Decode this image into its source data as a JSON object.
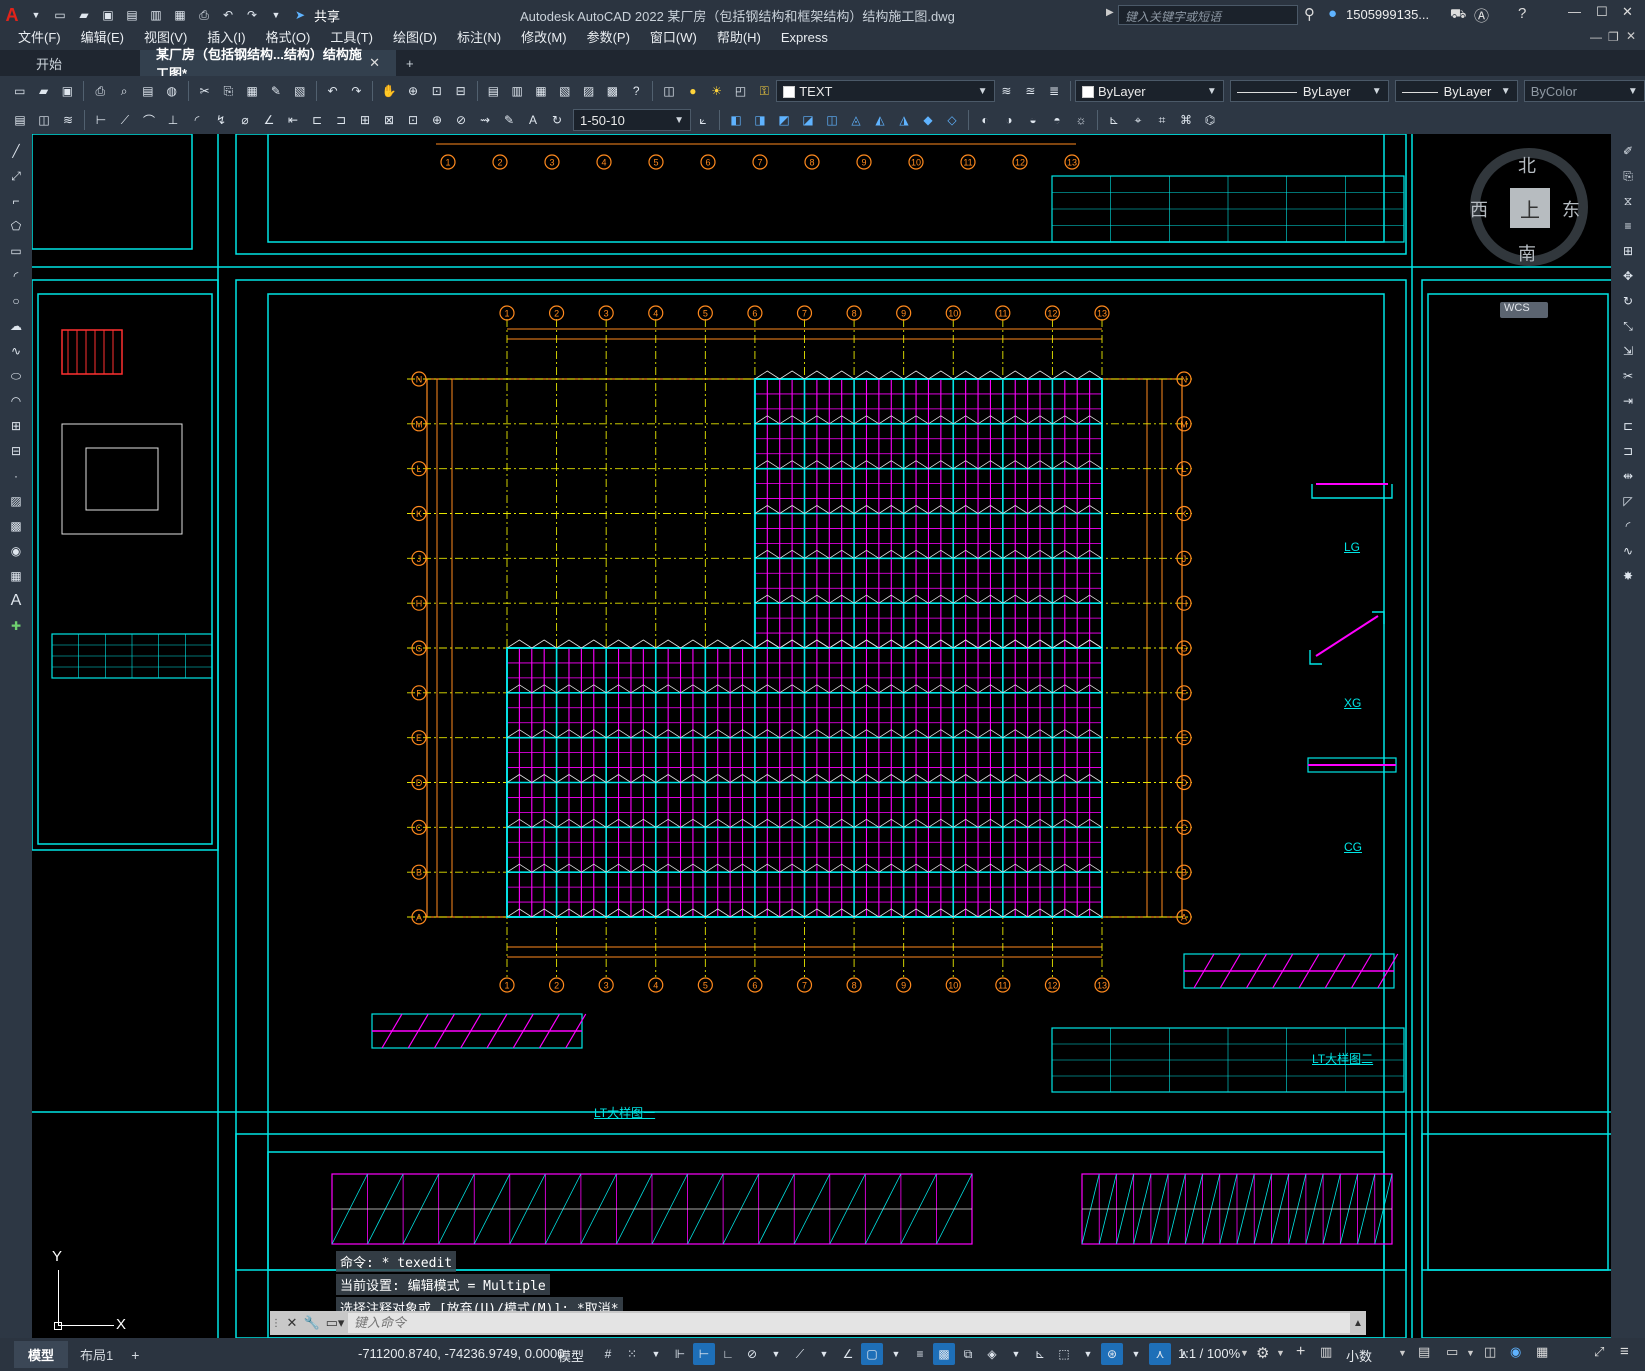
{
  "title_bar": {
    "share_label": "共享",
    "title": "Autodesk AutoCAD 2022    某厂房（包括钢结构和框架结构）结构施工图.dwg",
    "search_placeholder": "键入关键字或短语",
    "user": "1505999135..."
  },
  "menu": [
    "文件(F)",
    "编辑(E)",
    "视图(V)",
    "插入(I)",
    "格式(O)",
    "工具(T)",
    "绘图(D)",
    "标注(N)",
    "修改(M)",
    "参数(P)",
    "窗口(W)",
    "帮助(H)",
    "Express"
  ],
  "tabs": {
    "start": "开始",
    "active": "某厂房（包括钢结构...结构）结构施工图*"
  },
  "toolbar1": {
    "layer_name": "TEXT",
    "color": "ByLayer",
    "linetype": "ByLayer",
    "lineweight": "ByLayer",
    "plotstyle": "ByColor"
  },
  "toolbar2": {
    "dim_style": "1-50-10"
  },
  "compass": {
    "n": "北",
    "s": "南",
    "e": "东",
    "w": "西",
    "face": "上",
    "wcs": "WCS"
  },
  "drawing": {
    "axis_numbers": [
      "1",
      "2",
      "3",
      "4",
      "5",
      "6",
      "7",
      "8",
      "9",
      "10",
      "11",
      "12",
      "13"
    ],
    "axis_letters": [
      "N",
      "M",
      "L",
      "K",
      "J",
      "H",
      "G",
      "F",
      "E",
      "D",
      "C",
      "B",
      "A"
    ],
    "detail_labels": {
      "lg": "LG",
      "xg": "XG",
      "cg": "CG",
      "lt1": "LT大样图一",
      "lt2": "LT大样图二"
    },
    "ucs_x": "X",
    "ucs_y": "Y"
  },
  "command": {
    "history": [
      "命令: * texedit",
      "当前设置: 编辑模式 = Multiple",
      "选择注释对象或 [放弃(U)/模式(M)]: *取消*"
    ],
    "placeholder": "键入命令"
  },
  "status": {
    "model_tab": "模型",
    "layout_tab": "布局1",
    "add": "+",
    "coords": "-711200.8740, -74236.9749, 0.0000",
    "space": "模型",
    "scale": "1:1 / 100%",
    "units": "小数"
  }
}
